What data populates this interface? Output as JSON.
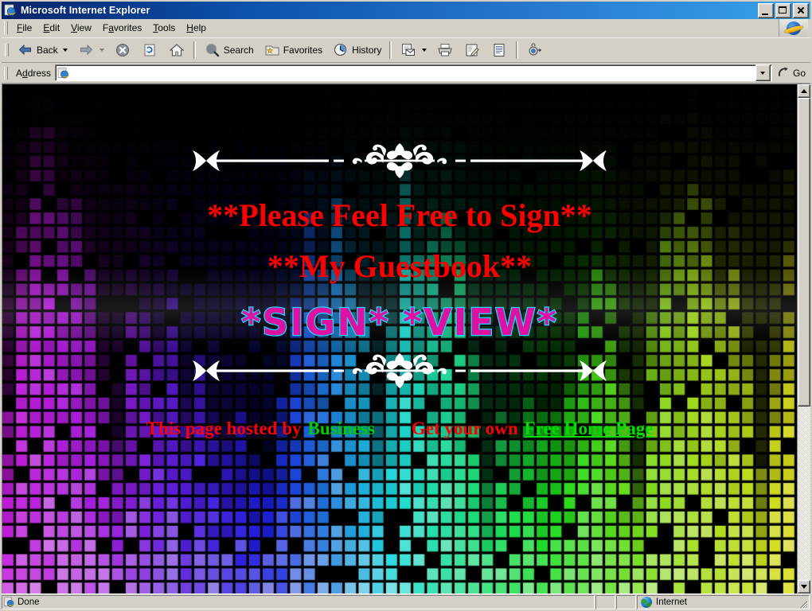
{
  "window": {
    "title": "Microsoft Internet Explorer",
    "icon": "ie-icon",
    "controls": {
      "minimize": "Minimize",
      "maximize": "Maximize",
      "close": "Close"
    }
  },
  "menubar": {
    "items": [
      {
        "label": "File",
        "accel": "F"
      },
      {
        "label": "Edit",
        "accel": "E"
      },
      {
        "label": "View",
        "accel": "V"
      },
      {
        "label": "Favorites",
        "accel": "a"
      },
      {
        "label": "Tools",
        "accel": "T"
      },
      {
        "label": "Help",
        "accel": "H"
      }
    ],
    "brand_icon": "ie-logo-icon"
  },
  "toolbar": {
    "back": {
      "label": "Back",
      "icon": "arrow-left-icon",
      "enabled": true
    },
    "forward": {
      "label": "",
      "icon": "arrow-right-icon",
      "enabled": false
    },
    "stop": {
      "label": "Stop",
      "icon": "stop-icon"
    },
    "refresh": {
      "label": "Refresh",
      "icon": "refresh-icon"
    },
    "home": {
      "label": "Home",
      "icon": "home-icon"
    },
    "search": {
      "label": "Search",
      "icon": "search-icon"
    },
    "favorites": {
      "label": "Favorites",
      "icon": "favorites-star-icon"
    },
    "history": {
      "label": "History",
      "icon": "history-clock-icon"
    },
    "mail": {
      "label": "Mail",
      "icon": "mail-icon"
    },
    "print": {
      "label": "Print",
      "icon": "printer-icon"
    },
    "edit": {
      "label": "Edit",
      "icon": "edit-pencil-icon"
    },
    "discuss": {
      "label": "Discuss",
      "icon": "document-icon"
    },
    "messenger": {
      "label": "Messenger",
      "icon": "messenger-icon"
    }
  },
  "address": {
    "label": "Address",
    "value": "",
    "placeholder": "",
    "icon": "ie-page-icon",
    "dropdown_icon": "chevron-down-icon",
    "go_label": "Go",
    "go_icon": "go-arrow-icon"
  },
  "page": {
    "headline_line1": "**Please Feel Free to Sign**",
    "headline_line2": "**My Guestbook**",
    "sign_link": "*SIGN*",
    "view_link": "*VIEW*",
    "footer": {
      "hosted_by_text": "This page hosted by",
      "host_name": "Business",
      "get_own_text": "Get your own",
      "free_page_link": "Free Home Page"
    },
    "divider_icon": "ornate-flourish-divider",
    "colors": {
      "headline": "#ff0000",
      "guestbook_fill": "#e010a0",
      "guestbook_stroke": "#14ddff",
      "host_name": "#00cc00",
      "free_page_link": "#00dd00",
      "background": "#000000"
    }
  },
  "scrollbar": {
    "up_icon": "triangle-up-icon",
    "down_icon": "triangle-down-icon",
    "thumb_position_percent": 0
  },
  "statusbar": {
    "status_text": "Done",
    "status_icon": "ie-page-icon",
    "zone_text": "Internet",
    "zone_icon": "globe-icon",
    "resize_grip_icon": "resize-grip-icon"
  }
}
